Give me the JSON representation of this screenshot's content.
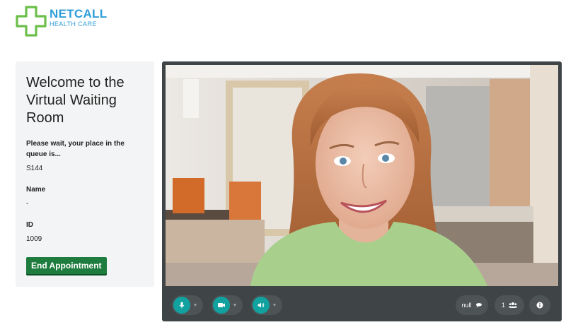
{
  "brand": {
    "name": "NETCALL",
    "subtitle": "HEALTH CARE",
    "primary_color": "#2e9ed8",
    "cross_color": "#6cbf4a"
  },
  "waiting_room": {
    "title": "Welcome to the Virtual Waiting Room",
    "queue_label": "Please wait, your place in the queue is...",
    "queue_value": "S144",
    "name_label": "Name",
    "name_value": "-",
    "id_label": "ID",
    "id_value": "1009",
    "end_button_label": "End Appointment"
  },
  "video": {
    "controls": {
      "mic_icon": "microphone-icon",
      "camera_icon": "video-camera-icon",
      "speaker_icon": "speaker-icon",
      "chat_label": "null",
      "chat_icon": "chat-bubble-icon",
      "participants_count": "1",
      "participants_icon": "users-icon",
      "info_icon": "info-icon",
      "accent_color": "#11a2a0"
    }
  }
}
